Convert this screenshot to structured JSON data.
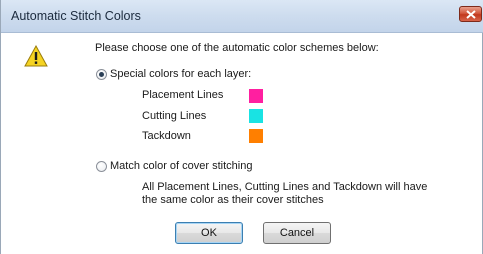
{
  "window": {
    "title": "Automatic Stitch Colors"
  },
  "dialog": {
    "prompt": "Please choose one of the automatic color schemes below:",
    "option_special": {
      "label": "Special colors for each layer:",
      "selected": true
    },
    "layers": [
      {
        "label": "Placement Lines",
        "color": "#ff1fa0"
      },
      {
        "label": "Cutting Lines",
        "color": "#19e3e3"
      },
      {
        "label": "Tackdown",
        "color": "#ff7f00"
      }
    ],
    "option_match": {
      "label": "Match color of cover stitching",
      "selected": false,
      "description_line1": "All Placement Lines, Cutting Lines and Tackdown will have",
      "description_line2": "the same color as their cover stitches"
    },
    "buttons": {
      "ok": "OK",
      "cancel": "Cancel"
    }
  }
}
